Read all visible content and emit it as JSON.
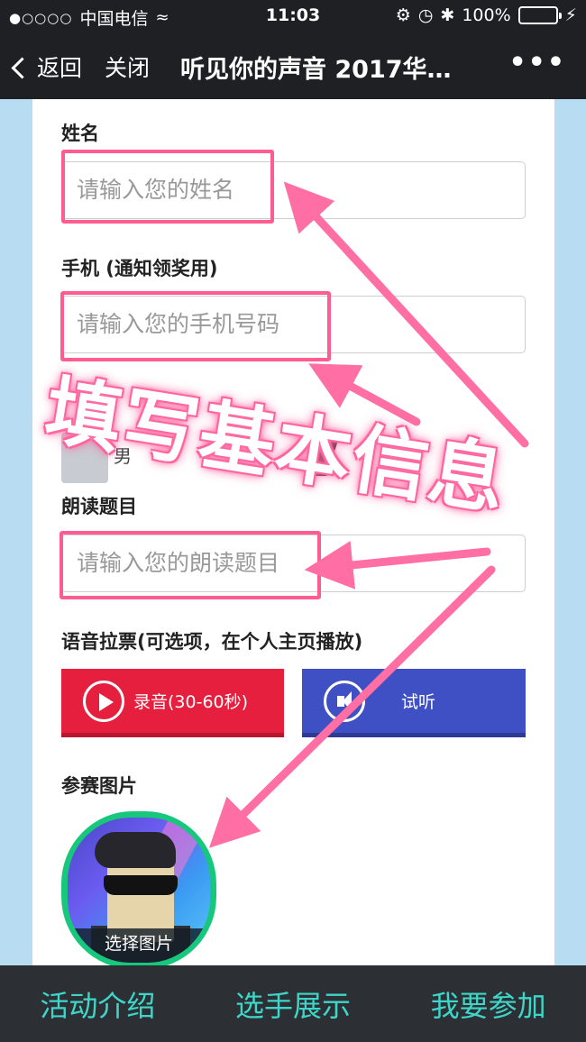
{
  "status_bar": {
    "signal": "●○○○○",
    "carrier": "中国电信",
    "time": "11:03",
    "battery": "100%"
  },
  "nav": {
    "back_label": "返回",
    "close_label": "关闭",
    "title": "听见你的声音 2017华…",
    "more_label": "•••"
  },
  "form": {
    "name_label": "姓名",
    "name_placeholder": "请输入您的姓名",
    "phone_label": "手机 (通知领奖用)",
    "phone_placeholder": "请输入您的手机号码",
    "gender_partial": "男",
    "topic_label": "朗读题目",
    "topic_placeholder": "请输入您的朗读题目",
    "vote_label": "语音拉票(可选项，在个人主页播放)",
    "record_button": "录音(30-60秒)",
    "listen_button": "试听",
    "photo_label": "参赛图片",
    "choose_photo": "选择图片"
  },
  "annotation": {
    "text": "填写基本信息",
    "color": "#ff5c92"
  },
  "bottom_nav": {
    "items": [
      "活动介绍",
      "选手展示",
      "我要参加"
    ],
    "color": "#3ed6c8"
  }
}
